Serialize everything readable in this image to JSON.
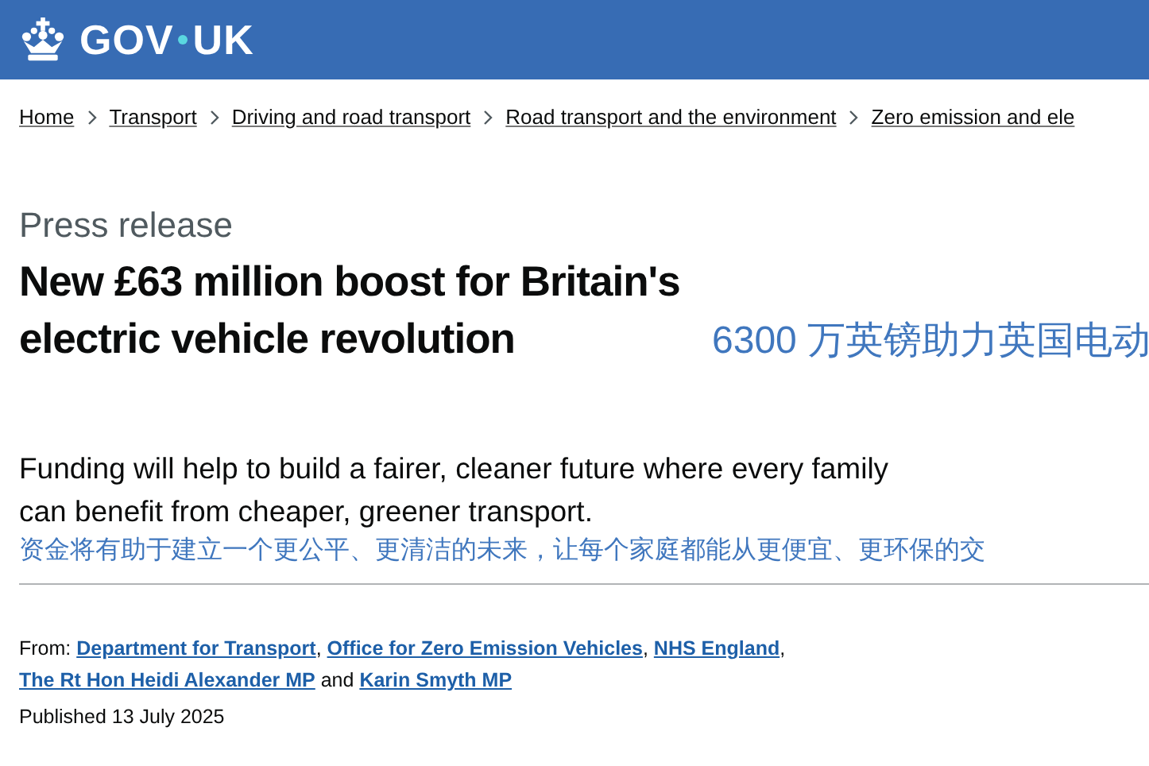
{
  "header": {
    "logo_text": "GOV",
    "logo_text_2": "UK"
  },
  "breadcrumbs": [
    {
      "text": "Home"
    },
    {
      "text": "Transport"
    },
    {
      "text": "Driving and road transport"
    },
    {
      "text": "Road transport and the environment"
    },
    {
      "text": "Zero emission and ele"
    }
  ],
  "article": {
    "type": "Press release",
    "title": "New £63 million boost for Britain's electric vehicle revolution",
    "title_translation": "6300 万英镑助力英国电动",
    "summary": "Funding will help to build a fairer, cleaner future where every family can benefit from cheaper, greener transport.",
    "summary_translation": "资金将有助于建立一个更公平、更清洁的未来，让每个家庭都能从更便宜、更环保的交"
  },
  "from": {
    "label": "From:",
    "links": [
      {
        "text": "Department for Transport",
        "after": ","
      },
      {
        "text": "Office for Zero Emission Vehicles",
        "after": ","
      },
      {
        "text": "NHS England",
        "after": ","
      },
      {
        "text": "The Rt Hon Heidi Alexander MP",
        "after": "and"
      },
      {
        "text": "Karin Smyth MP"
      }
    ]
  },
  "published": "Published 13 July 2025"
}
